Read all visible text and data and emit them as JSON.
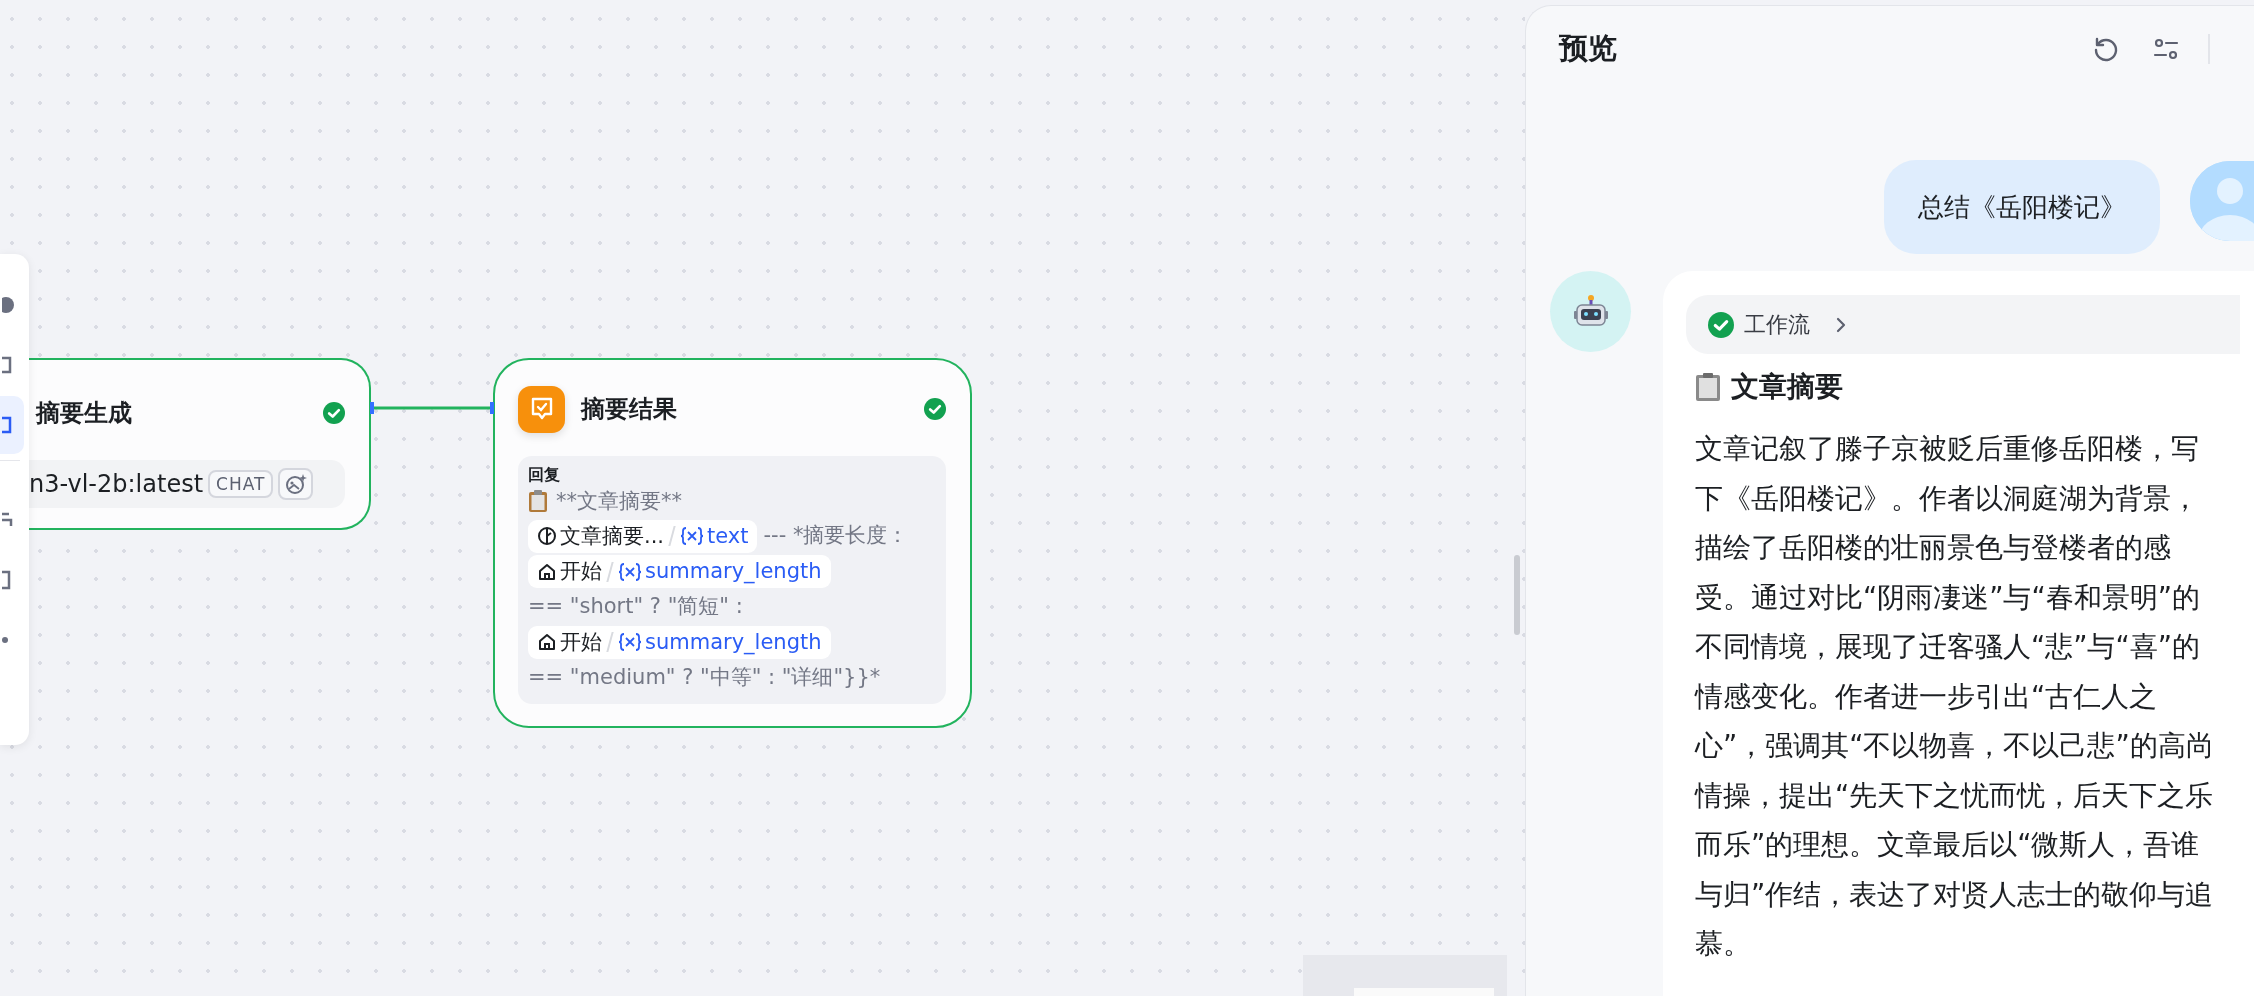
{
  "canvas": {
    "toolbar": {
      "items": [
        {
          "selected": false
        },
        {
          "selected": false
        },
        {
          "selected": true
        },
        {
          "selected": false
        },
        {
          "selected": false
        },
        {
          "selected": false
        }
      ]
    },
    "nodes": [
      {
        "kind": "llm",
        "title": "摘要生成",
        "done": true,
        "model": "n3-vl-2b:latest",
        "model_tag": "CHAT"
      },
      {
        "kind": "reply",
        "title": "摘要结果",
        "done": true,
        "reply": {
          "label": "回复",
          "segments": [
            {
              "kind": "title",
              "text": "**文章摘要**"
            },
            {
              "kind": "llm_variable",
              "node": "文章摘要...",
              "variable": "text"
            },
            {
              "kind": "text",
              "text": "--- *摘要长度："
            },
            {
              "kind": "start_variable",
              "node": "开始",
              "variable": "summary_length"
            },
            {
              "kind": "text",
              "text": "== \"short\" ? \"简短\" :"
            },
            {
              "kind": "start_variable",
              "node": "开始",
              "variable": "summary_length"
            },
            {
              "kind": "text",
              "text": "== \"medium\" ? \"中等\" : \"详细\"}}*"
            }
          ]
        }
      }
    ]
  },
  "preview": {
    "title": "预览",
    "messages": [
      {
        "kind": "user",
        "text": "总结《岳阳楼记》"
      },
      {
        "kind": "assistant",
        "workflow": {
          "label": "工作流",
          "done": true
        },
        "heading": "文章摘要",
        "body": "文章记叙了滕子京被贬后重修岳阳楼，写下《岳阳楼记》。作者以洞庭湖为背景，描绘了岳阳楼的壮丽景色与登楼者的感受。通过对比“阴雨凄迷”与“春和景明”的不同情境，展现了迁客骚人“悲”与“喜”的情感变化。作者进一步引出“古仁人之心”，强调其“不以物喜，不以己悲”的高尚情操，提出“先天下之忧而忧，后天下之乐而乐”的理想。文章最后以“微斯人，吾谁与归”作结，表达了对贤人志士的敬仰与追慕。"
      }
    ]
  }
}
